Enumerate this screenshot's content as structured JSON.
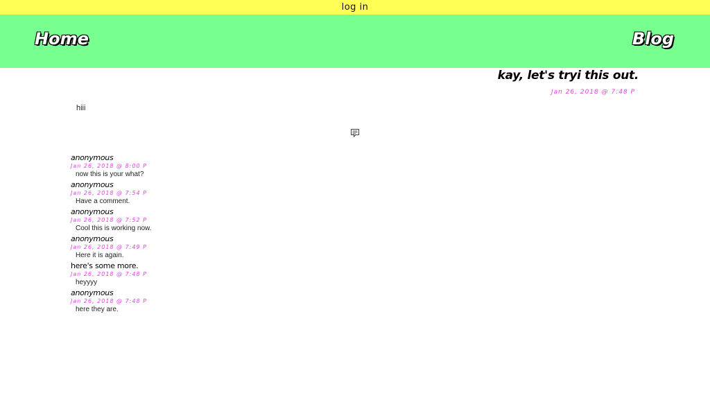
{
  "topbar": {
    "login_label": "log in"
  },
  "nav": {
    "home_label": "Home",
    "blog_label": "Blog"
  },
  "post": {
    "title": "kay, let's tryi this out.",
    "date": "Jan 26, 2018 @ 7:48 P",
    "body": "hiii",
    "comment_icon": "comment-icon"
  },
  "comments": [
    {
      "author": "anonymous",
      "date": "Jan 26, 2018 @ 8:00 P",
      "text": "now this is your what?"
    },
    {
      "author": "anonymous",
      "date": "Jan 26, 2018 @ 7:54 P",
      "text": "Have a comment."
    },
    {
      "author": "anonymous",
      "date": "Jan 26, 2018 @ 7:52 P",
      "text": "Cool this is working now."
    },
    {
      "author": "anonymous",
      "date": "Jan 26, 2018 @ 7:49 P",
      "text": "Here it is again."
    },
    {
      "author": "here's some more.",
      "date": "Jan 26, 2018 @ 7:48 P",
      "text": "heyyyy"
    },
    {
      "author": "anonymous",
      "date": "Jan 26, 2018 @ 7:48 P",
      "text": "here they are."
    }
  ],
  "colors": {
    "topbar_bg": "#ffff55",
    "nav_bg": "#77ff8f",
    "date_accent": "#e040e0"
  }
}
